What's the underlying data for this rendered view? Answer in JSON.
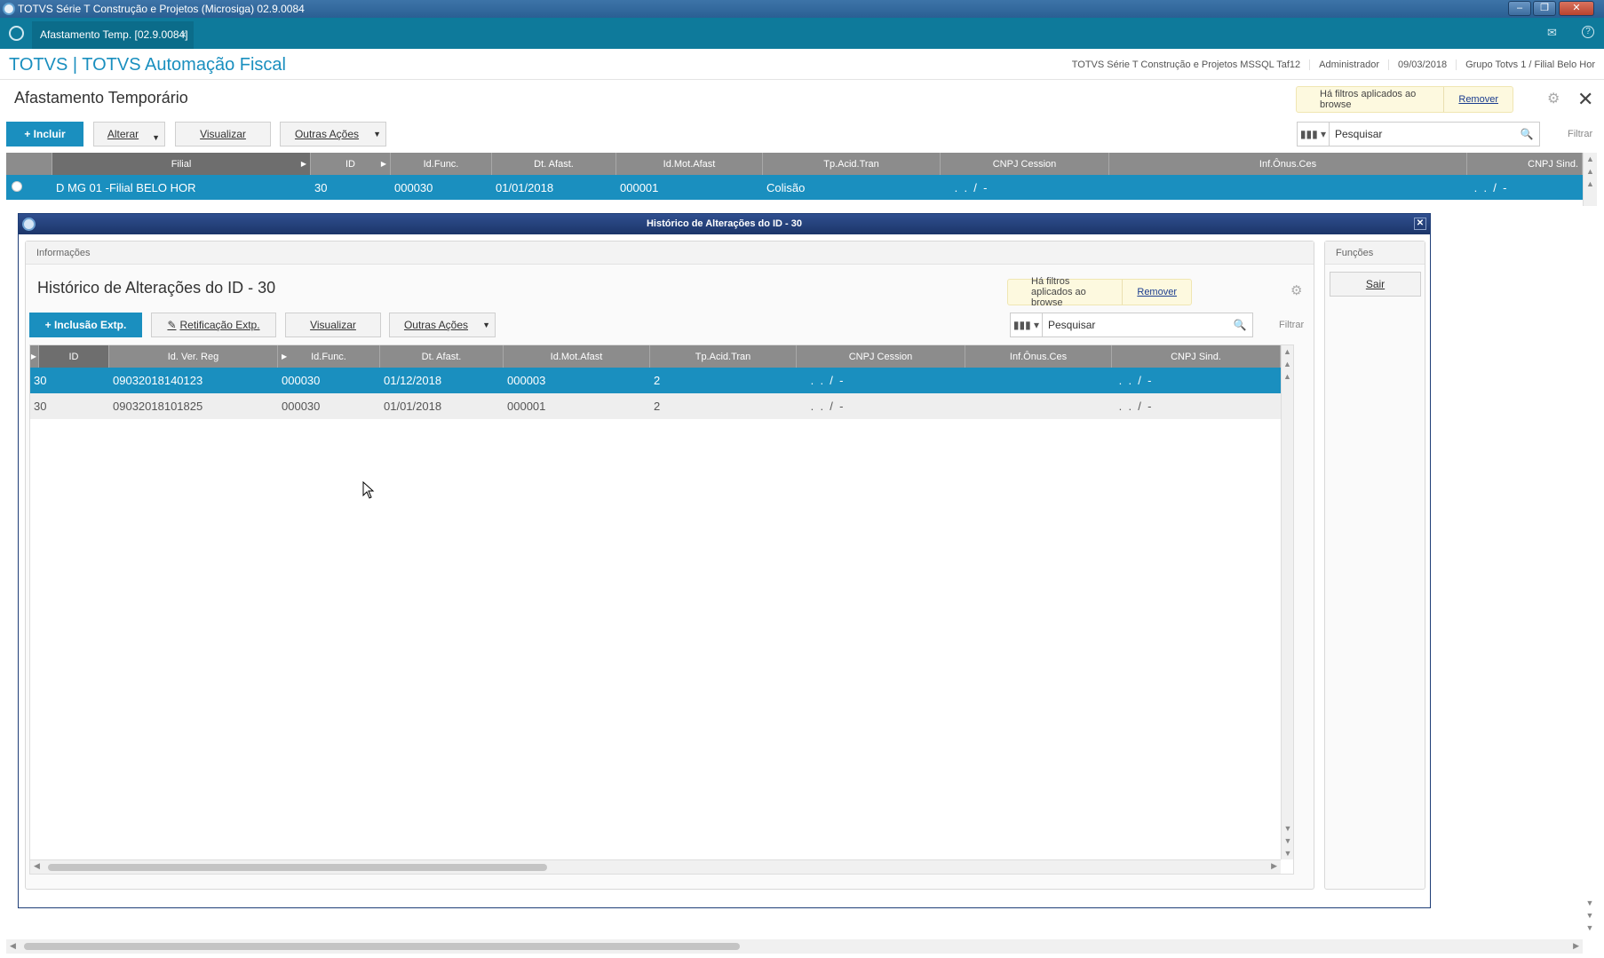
{
  "window": {
    "title": "TOTVS Série T Construção e Projetos (Microsiga) 02.9.0084",
    "controls": [
      "‒",
      "❐",
      "✕"
    ]
  },
  "tab": {
    "label": "Afastamento Temp. [02.9.0084]",
    "close": "×"
  },
  "header": {
    "brand": "TOTVS | TOTVS Automação Fiscal",
    "environment": "TOTVS Série T Construção e Projetos MSSQL Taf12",
    "user": "Administrador",
    "date": "09/03/2018",
    "company": "Grupo Totvs 1 / Filial Belo Hor"
  },
  "main": {
    "title": "Afastamento Temporário",
    "filter_notice": "Há filtros aplicados ao browse",
    "remove_label": "Remover",
    "buttons": {
      "incluir": "+ Incluir",
      "alterar": "Alterar",
      "visualizar": "Visualizar",
      "outras": "Outras Ações"
    },
    "search_placeholder": "Pesquisar",
    "filtrar": "Filtrar",
    "columns": [
      "Filial",
      "ID",
      "Id.Func.",
      "Dt. Afast.",
      "Id.Mot.Afast",
      "Tp.Acid.Tran",
      "CNPJ Cession",
      "Inf.Ônus.Ces",
      "CNPJ Sind."
    ],
    "rows": [
      {
        "filial": "D MG 01 -Filial BELO HOR",
        "id": "30",
        "idfunc": "000030",
        "dtafast": "01/01/2018",
        "idmot": "000001",
        "tpacid": "Colisão",
        "cnpjcess": " .  .  /  -",
        "infonus": "",
        "cnpjsind": " .  .  /  -"
      }
    ]
  },
  "dialog": {
    "title": "Histórico de Alterações do ID - 30",
    "info_panel": "Informações",
    "func_panel": "Funções",
    "sair": "Sair",
    "heading": "Histórico de Alterações do ID - 30",
    "filter_notice": "Há filtros aplicados ao browse",
    "remove_label": "Remover",
    "buttons": {
      "inclusao": "+ Inclusão Extp.",
      "retificacao": "Retificação Extp.",
      "visualizar": "Visualizar",
      "outras": "Outras Ações"
    },
    "search_placeholder": "Pesquisar",
    "filtrar": "Filtrar",
    "columns": [
      "ID",
      "Id. Ver. Reg",
      "Id.Func.",
      "Dt. Afast.",
      "Id.Mot.Afast",
      "Tp.Acid.Tran",
      "CNPJ Cession",
      "Inf.Ônus.Ces",
      "CNPJ Sind."
    ],
    "rows": [
      {
        "id": "30",
        "verreg": "09032018140123",
        "idfunc": "000030",
        "dtafast": "01/12/2018",
        "idmot": "000003",
        "tpacid": "2",
        "cnpjcess": " .  .  /  -",
        "infonus": "",
        "cnpjsind": " .  .  /  -"
      },
      {
        "id": "30",
        "verreg": "09032018101825",
        "idfunc": "000030",
        "dtafast": "01/01/2018",
        "idmot": "000001",
        "tpacid": "2",
        "cnpjcess": " .  .  /  -",
        "infonus": "",
        "cnpjsind": " .  .  /  -"
      }
    ]
  },
  "colors": {
    "accent": "#1a8fbf",
    "tabbar": "#0e7a9b",
    "grid_header": "#8c8c8c",
    "dialog_title": "#1c3569"
  }
}
